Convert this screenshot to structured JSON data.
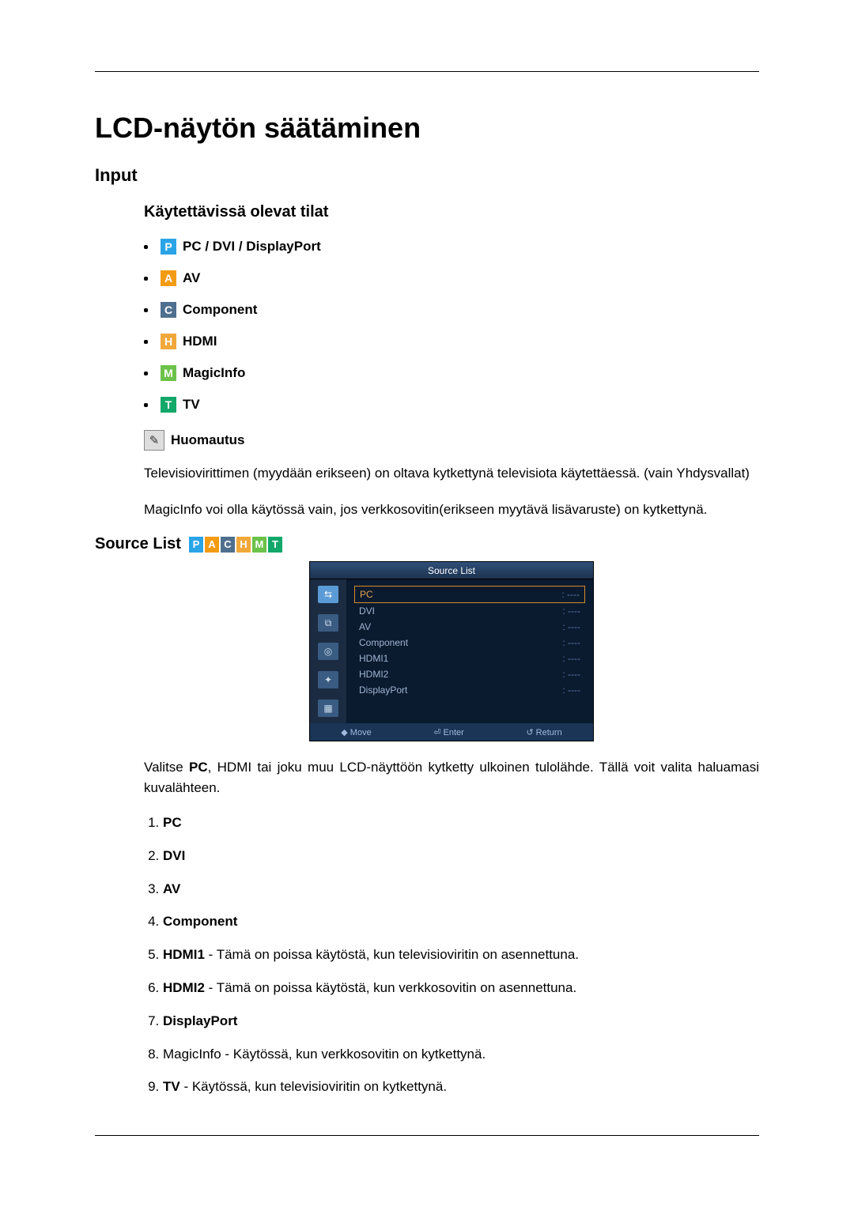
{
  "title": "LCD-näytön säätäminen",
  "input_heading": "Input",
  "modes_heading": "Käytettävissä olevat tilat",
  "modes": [
    {
      "letter": "P",
      "cssClass": "icon-P",
      "label": "PC / DVI / DisplayPort"
    },
    {
      "letter": "A",
      "cssClass": "icon-A",
      "label": "AV"
    },
    {
      "letter": "C",
      "cssClass": "icon-C",
      "label": "Component"
    },
    {
      "letter": "H",
      "cssClass": "icon-H",
      "label": "HDMI"
    },
    {
      "letter": "M",
      "cssClass": "icon-M",
      "label": "MagicInfo"
    },
    {
      "letter": "T",
      "cssClass": "icon-T",
      "label": "TV"
    }
  ],
  "note_label": "Huomautus",
  "note_icon_glyph": "✎",
  "note_para1": "Televisiovirittimen (myydään erikseen) on oltava kytkettynä televisiota käytettäessä. (vain Yhdysvallat)",
  "note_para2": "MagicInfo voi olla käytössä vain, jos verkkosovitin(erikseen myytävä lisävaruste) on kytkettynä.",
  "sourcelist_label": "Source List",
  "osd": {
    "title": "Source List",
    "side": [
      "⇆",
      "⧉",
      "◎",
      "✦",
      "▦"
    ],
    "rows": [
      {
        "name": "PC",
        "val": "----",
        "selected": true
      },
      {
        "name": "DVI",
        "val": "----"
      },
      {
        "name": "AV",
        "val": "----"
      },
      {
        "name": "Component",
        "val": "----"
      },
      {
        "name": "HDMI1",
        "val": "----"
      },
      {
        "name": "HDMI2",
        "val": "----"
      },
      {
        "name": "DisplayPort",
        "val": "----"
      }
    ],
    "foot": [
      "◆ Move",
      "⏎ Enter",
      "↺ Return"
    ]
  },
  "sourcelist_para": "Valitse <b>PC</b>, HDMI tai joku muu LCD-näyttöön kytketty ulkoinen tulolähde. Tällä voit valita haluamasi kuvalähteen.",
  "numbered": [
    {
      "bold": "PC"
    },
    {
      "bold": "DVI"
    },
    {
      "bold": "AV"
    },
    {
      "bold": "Component"
    },
    {
      "bold": "HDMI1",
      "rest": " - Tämä on poissa käytöstä, kun televisioviritin on asennettuna."
    },
    {
      "bold": "HDMI2",
      "rest": " - Tämä on poissa käytöstä, kun verkkosovitin on asennettuna."
    },
    {
      "bold": "DisplayPort"
    },
    {
      "plain": "MagicInfo - Käytössä, kun verkkosovitin on kytkettynä."
    },
    {
      "bold": "TV",
      "rest": " - Käytössä, kun televisioviritin on kytkettynä."
    }
  ]
}
